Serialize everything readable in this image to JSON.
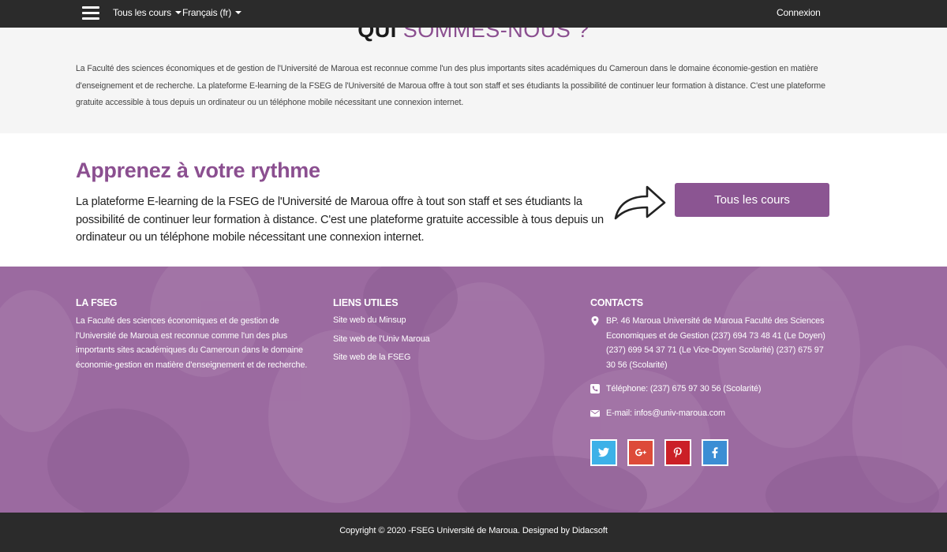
{
  "navbar": {
    "courses_label": "Tous les cours",
    "language_label": "Français (fr)",
    "login_label": "Connexion"
  },
  "about": {
    "title_part1": "QUI",
    "title_part2": "SOMMES-NOUS ?",
    "text": "La Faculté des sciences économiques et de gestion de l'Université de Maroua est reconnue comme l'un des plus importants sites académiques du Cameroun dans le domaine économie-gestion en matière d'enseignement et de recherche. La plateforme E-learning de la FSEG de l'Université de Maroua offre à tout son staff et ses étudiants la possibilité de continuer leur formation à distance. C'est une plateforme gratuite accessible à tous depuis un ordinateur ou un téléphone mobile nécessitant une connexion internet."
  },
  "learn": {
    "title": "Apprenez à votre rythme",
    "text": "La plateforme E-learning de la FSEG de l'Université de Maroua offre à tout son staff et ses étudiants la possibilité de continuer leur formation à distance. C'est une plateforme gratuite accessible à tous depuis un ordinateur ou un téléphone mobile nécessitant une connexion internet.",
    "button_label": "Tous les cours"
  },
  "footer": {
    "fseg": {
      "heading": "LA FSEG",
      "text": "La Faculté des sciences économiques et de gestion de l'Université de Maroua est reconnue comme l'un des plus importants sites académiques du Cameroun dans le domaine économie-gestion en matière d'enseignement et de recherche."
    },
    "links": {
      "heading": "LIENS UTILES",
      "items": [
        "Site web du Minsup",
        "Site web de l'Univ Maroua",
        "Site web de la FSEG"
      ]
    },
    "contacts": {
      "heading": "CONTACTS",
      "address": "BP. 46 Maroua Université de Maroua Faculté des Sciences Economiques et de Gestion (237) 694 73 48 41 (Le Doyen) (237) 699 54 37 71 (Le Vice-Doyen Scolarité) (237) 675 97 30 56 (Scolarité)",
      "phone": "Téléphone: (237) 675 97 30 56 (Scolarité)",
      "email": "E-mail: infos@univ-maroua.com"
    },
    "social": [
      {
        "name": "twitter",
        "color": "#3cb1e8"
      },
      {
        "name": "google-plus",
        "color": "#dd4b39"
      },
      {
        "name": "pinterest",
        "color": "#cb2027"
      },
      {
        "name": "facebook",
        "color": "#3b8ed4"
      }
    ]
  },
  "copyright": "Copyright © 2020 -FSEG Université de Maroua. Designed by Didacsoft",
  "colors": {
    "brand_purple": "#8b4f90",
    "navbar_bg": "#2b2b2b",
    "footer_bg": "#9b6aa0"
  }
}
